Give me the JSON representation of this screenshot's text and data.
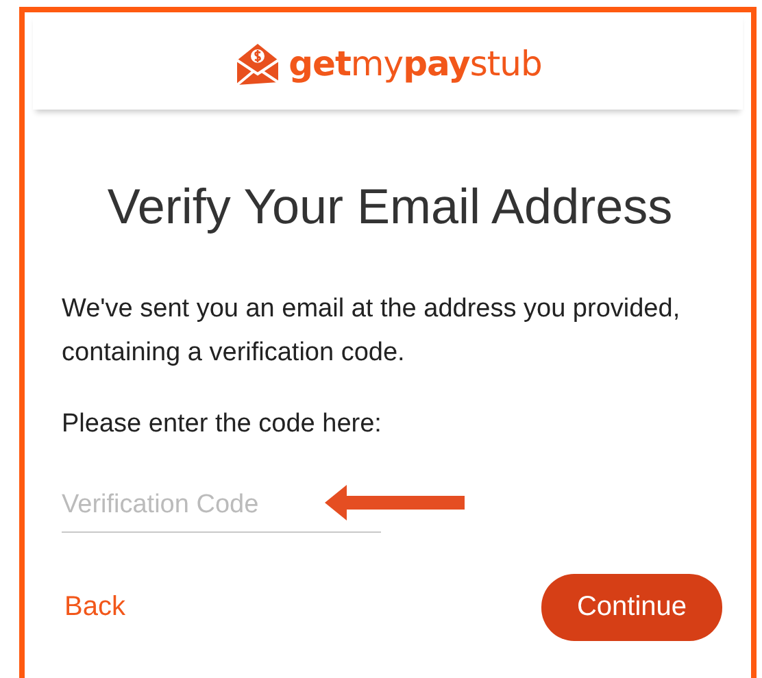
{
  "logo": {
    "text": "**get**my**pay**stub"
  },
  "title": "Verify Your Email Address",
  "message": "We've sent you an email at the address you provided, containing a verification code.",
  "prompt": "Please enter the code here:",
  "code_field": {
    "placeholder": "Verification Code"
  },
  "buttons": {
    "back": "Back",
    "continue": "Continue"
  }
}
